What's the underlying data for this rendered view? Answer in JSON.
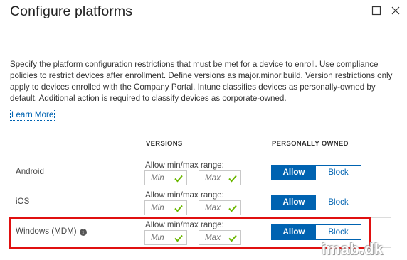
{
  "window": {
    "title": "Configure platforms",
    "maximize_icon": "maximize-icon",
    "close_icon": "close-icon"
  },
  "description": {
    "text": "Specify the platform configuration restrictions that must be met for a device to enroll. Use compliance policies to restrict devices after enrollment. Define versions as major.minor.build. Version restrictions only apply to devices enrolled with the Company Portal. Intune classifies devices as personally-owned by default. Additional action is required to classify devices as corporate-owned.",
    "learn_more": "Learn More"
  },
  "table": {
    "headers": {
      "versions": "VERSIONS",
      "personally_owned": "PERSONALLY OWNED"
    },
    "range_label": "Allow min/max range:",
    "min_placeholder": "Min",
    "max_placeholder": "Max",
    "rows": [
      {
        "platform": "Android",
        "has_info_icon": false,
        "selected": "Allow",
        "allow_label": "Allow",
        "block_label": "Block"
      },
      {
        "platform": "iOS",
        "has_info_icon": false,
        "selected": "Allow",
        "allow_label": "Allow",
        "block_label": "Block"
      },
      {
        "platform": "Windows (MDM)",
        "has_info_icon": true,
        "selected": "Allow",
        "allow_label": "Allow",
        "block_label": "Block"
      }
    ]
  },
  "colors": {
    "accent": "#0063b1",
    "check": "#6bb700",
    "highlight": "#e01010"
  },
  "watermark": "imab.dk"
}
